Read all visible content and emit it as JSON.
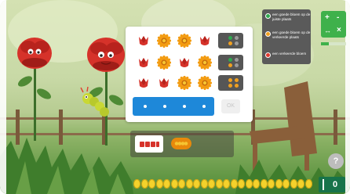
{
  "legend": {
    "items": [
      {
        "label": "een goede bloem op de juiste plaats",
        "color": "#2fa84f"
      },
      {
        "label": "een goede bloem op de verkeerde plaats",
        "color": "#f0a020"
      },
      {
        "label": "een verkeerde bloem",
        "color": "#e03a2f"
      }
    ]
  },
  "guess_grid": [
    [
      "tulip",
      "sunflower",
      "sunflower",
      "tulip"
    ],
    [
      "tulip",
      "sunflower",
      "tulip",
      "sunflower"
    ],
    [
      "tulip",
      "tulip",
      "sunflower",
      "sunflower"
    ]
  ],
  "feedback": [
    [
      "green",
      "grey",
      "orange",
      "grey"
    ],
    [
      "green",
      "grey",
      "orange",
      "grey"
    ],
    [
      "orange",
      "orange",
      "orange",
      "orange"
    ]
  ],
  "feedback_colors": {
    "green": "#2fa84f",
    "orange": "#f0a020",
    "grey": "#9a9a9a",
    "red": "#e03a2f"
  },
  "answer_slots": 4,
  "ok_label": "OK",
  "zoom_controls": {
    "plus": "+",
    "minus": "-",
    "fit": "↔",
    "close": "×",
    "level": 0.3
  },
  "help_label": "?",
  "coins": {
    "count": 24
  },
  "score": "0"
}
